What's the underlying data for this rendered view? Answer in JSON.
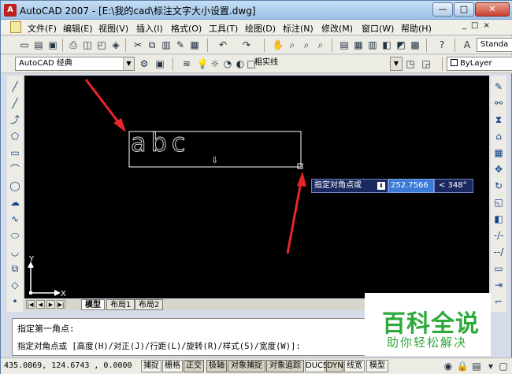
{
  "window": {
    "title": "AutoCAD 2007 - [E:\\我的cad\\标注文字大小设置.dwg]",
    "app_icon_letter": "A",
    "minimize_glyph": "—",
    "maximize_glyph": "□",
    "close_glyph": "✕"
  },
  "menu": {
    "items": [
      "文件(F)",
      "编辑(E)",
      "视图(V)",
      "插入(I)",
      "格式(O)",
      "工具(T)",
      "绘图(D)",
      "标注(N)",
      "修改(M)",
      "窗口(W)",
      "帮助(H)"
    ],
    "doc_controls": "_□×"
  },
  "toolbar2": {
    "workspace": "AutoCAD 经典",
    "layer": "粗实线",
    "bylayer": "ByLayer"
  },
  "toolbar1": {
    "style_combo": "Standa"
  },
  "drawing": {
    "text_preview": "abc",
    "axis_y": "Y",
    "axis_x": "X",
    "prompt_tooltip": "指定对角点或",
    "distance_value": "252.7566",
    "angle_value": "< 348°",
    "background": "#000000"
  },
  "layout_tabs": [
    "模型",
    "布局1",
    "布局2"
  ],
  "command": {
    "line1": "指定第一角点:",
    "line2": "指定对角点或 [高度(H)/对正(J)/行距(L)/旋转(R)/样式(S)/宽度(W)]:"
  },
  "watermark": {
    "big": "百科全说",
    "small": "助你轻松解决"
  },
  "status": {
    "coords": "435.0869, 124.6743 , 0.0000",
    "buttons": [
      "捕捉",
      "栅格",
      "正交",
      "极轴",
      "对象捕捉",
      "对象追踪",
      "DUCS",
      "DYN",
      "线宽",
      "模型"
    ]
  },
  "colors": {
    "arrow": "#e8262a",
    "watermark": "#2eaa3c",
    "input_highlight": "#3a7ad8"
  }
}
